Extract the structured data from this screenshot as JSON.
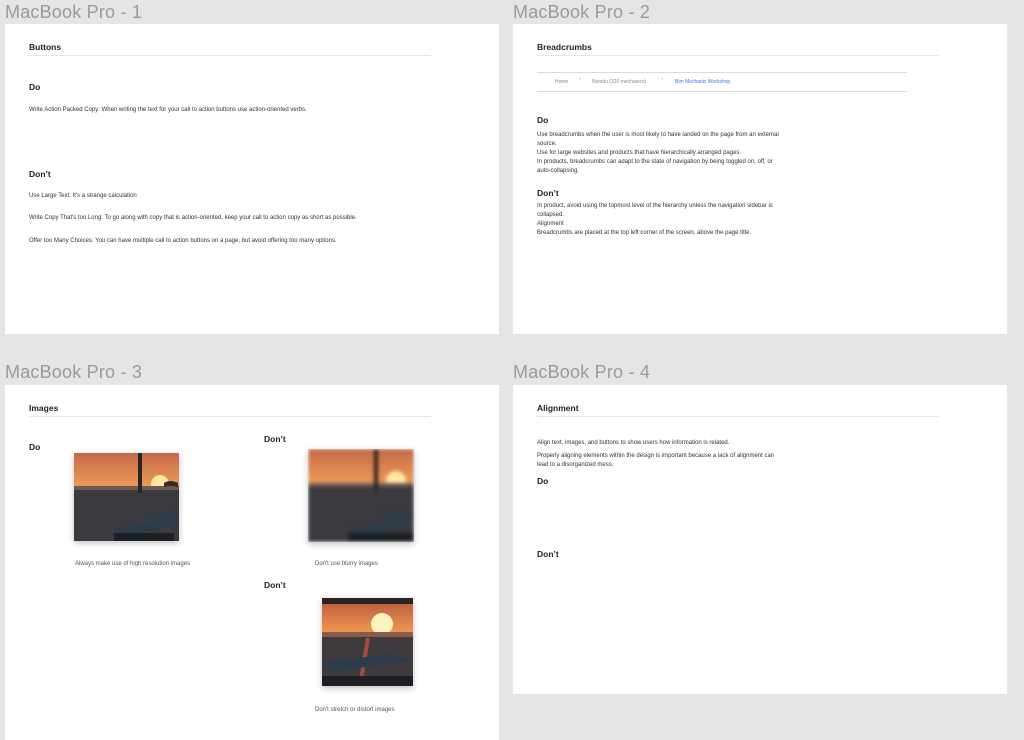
{
  "frames": {
    "f1": {
      "label": "MacBook Pro - 1",
      "title": "Buttons",
      "do_heading": "Do",
      "do_text": "Write Action Packed Copy: When writing the text for your call to action buttons use action-oriented verbs.",
      "dont_heading": "Don’t",
      "dont_items": [
        "Use Large Text: It's a strange calculation",
        "Write Copy That's too Long: To go along with copy that is action-oriented, keep your call to action copy as short as possible.",
        "Offer too Many Choices: You can have multiple call to action buttons on a page, but avoid offering too many options."
      ]
    },
    "f2": {
      "label": "MacBook Pro - 2",
      "title": "Breadcrumbs",
      "crumbs": [
        "Home",
        "Nonidu (320 mechanics)",
        "Bim Mechanic Workshop"
      ],
      "do_heading": "Do",
      "do_lines": [
        "Use breadcrumbs when the user is most likely to have landed on the page from an external",
        "source.",
        "Use for large websites and products that have hierarchically arranged pages.",
        "In products, breadcrumbs can adapt to the state of navigation by being toggled on, off, or",
        "auto-collapsing."
      ],
      "dont_heading": "Don’t",
      "dont_lines": [
        "In product, avoid using the topmost level of the hierarchy unless the navigation sidebar is",
        "collapsed.",
        "Alignment",
        "Breadcrumbs are placed at the top left corner of the screen, above the page title."
      ]
    },
    "f3": {
      "label": "MacBook Pro - 3",
      "title": "Images",
      "do_heading": "Do",
      "dont_heading_1": "Don’t",
      "dont_heading_2": "Don’t",
      "cap_do": "Always make use of high resolution images",
      "cap_blur": "Don't use blurry images",
      "cap_stretch": "Don't stretch or distort images"
    },
    "f4": {
      "label": "MacBook Pro - 4",
      "title": "Alignment",
      "line1": "Align text, images, and buttons to show users how information is related.",
      "line2": "Properly aligning elements within the design is important because a lack of alignment can",
      "line3": "lead to a disorganized mess.",
      "do_heading": "Do",
      "dont_heading": "Don’t"
    }
  },
  "colors": {
    "canvas": "#e5e5e5",
    "frame": "#ffffff",
    "label": "#9a9a9a",
    "crumb_active": "#3a73e8"
  }
}
